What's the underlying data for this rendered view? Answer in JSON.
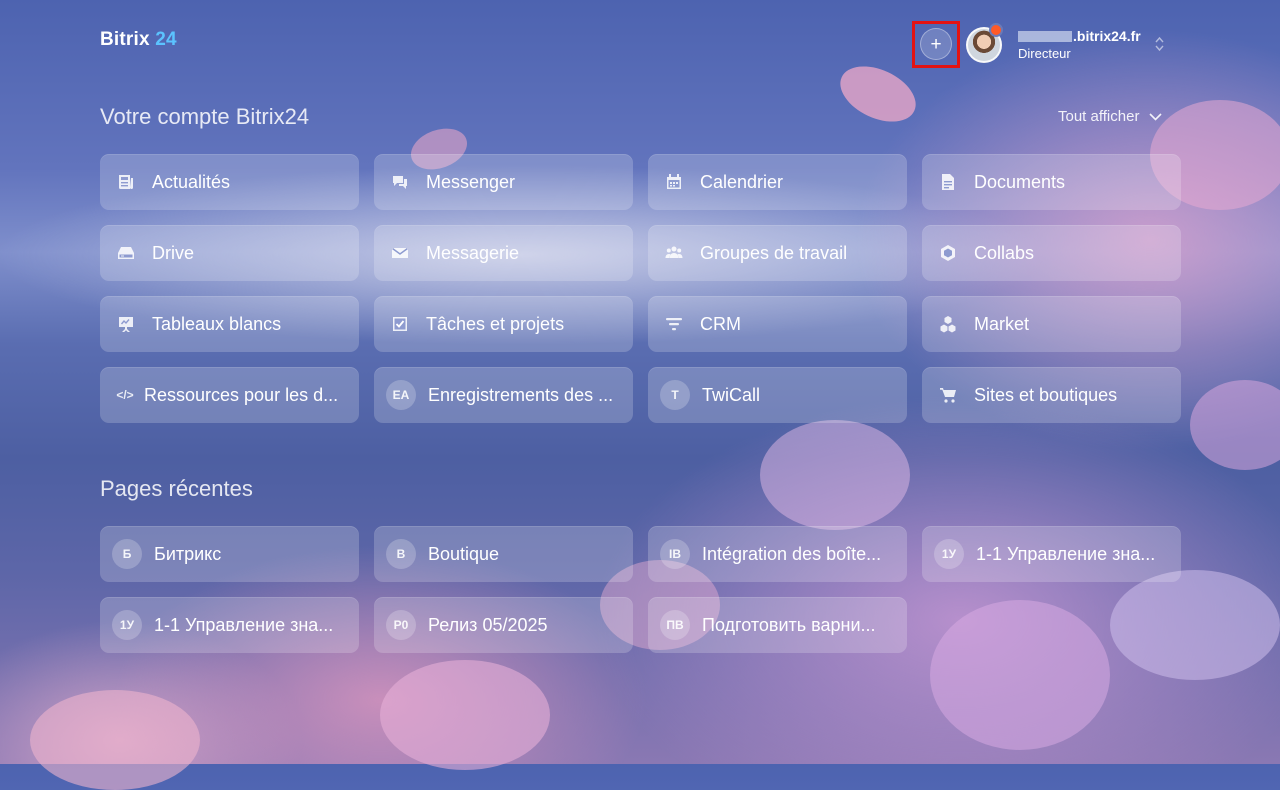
{
  "header": {
    "logo_text": "Bitrix",
    "logo_number": "24",
    "add_button_label": "+",
    "account_domain": ".bitrix24.fr",
    "account_role": "Directeur"
  },
  "account_section": {
    "title": "Votre compte Bitrix24",
    "show_all_label": "Tout afficher",
    "tiles": [
      {
        "label": "Actualités",
        "icon": "newspaper-icon"
      },
      {
        "label": "Messenger",
        "icon": "chat-icon"
      },
      {
        "label": "Calendrier",
        "icon": "calendar-icon"
      },
      {
        "label": "Documents",
        "icon": "document-icon"
      },
      {
        "label": "Drive",
        "icon": "drive-icon"
      },
      {
        "label": "Messagerie",
        "icon": "mail-icon"
      },
      {
        "label": "Groupes de travail",
        "icon": "group-icon"
      },
      {
        "label": "Collabs",
        "icon": "hexagon-icon"
      },
      {
        "label": "Tableaux blancs",
        "icon": "whiteboard-icon"
      },
      {
        "label": "Tâches et projets",
        "icon": "task-icon"
      },
      {
        "label": "CRM",
        "icon": "filter-icon"
      },
      {
        "label": "Market",
        "icon": "blocks-icon"
      },
      {
        "label": "Ressources pour les d...",
        "icon": "code-icon",
        "glyph": "</>"
      },
      {
        "label": "Enregistrements des ...",
        "icon": "initials-avatar",
        "initials": "EA"
      },
      {
        "label": "TwiCall",
        "icon": "initials-avatar",
        "initials": "T"
      },
      {
        "label": "Sites et boutiques",
        "icon": "cart-icon"
      }
    ]
  },
  "recent_section": {
    "title": "Pages récentes",
    "pages": [
      {
        "initials": "Б",
        "label": "Битрикс"
      },
      {
        "initials": "B",
        "label": "Boutique"
      },
      {
        "initials": "IB",
        "label": "Intégration des boîte..."
      },
      {
        "initials": "1У",
        "label": "1-1 Управление зна..."
      },
      {
        "initials": "1У",
        "label": "1-1 Управление зна..."
      },
      {
        "initials": "Р0",
        "label": "Релиз 05/2025"
      },
      {
        "initials": "ПВ",
        "label": "Подготовить варни..."
      }
    ]
  },
  "colors": {
    "logo_accent": "#5bc3ff",
    "highlight_border": "#e31313",
    "notification_dot": "#ff5a27"
  }
}
